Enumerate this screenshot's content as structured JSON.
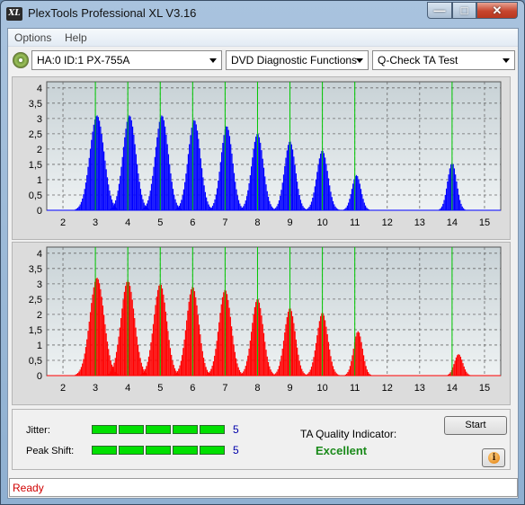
{
  "window": {
    "title": "PlexTools Professional XL V3.16",
    "icon_text": "XL"
  },
  "menu": [
    {
      "label": "Options"
    },
    {
      "label": "Help"
    }
  ],
  "toolbar": {
    "drive": "HA:0 ID:1  PX-755A",
    "function": "DVD Diagnostic Functions",
    "test": "Q-Check TA Test"
  },
  "graphs": {
    "x_ticks": [
      "2",
      "3",
      "4",
      "5",
      "6",
      "7",
      "8",
      "9",
      "10",
      "11",
      "12",
      "13",
      "14",
      "15"
    ],
    "y_ticks": [
      "4",
      "3,5",
      "3",
      "2,5",
      "2",
      "1,5",
      "1",
      "0,5",
      "0"
    ]
  },
  "chart_data": [
    {
      "type": "histogram",
      "series": [
        {
          "color": "#0000ff",
          "peaks": [
            {
              "center": 3.05,
              "height": 3.1,
              "sigma": 0.22
            },
            {
              "center": 4.05,
              "height": 3.1,
              "sigma": 0.2
            },
            {
              "center": 5.05,
              "height": 3.1,
              "sigma": 0.2
            },
            {
              "center": 6.05,
              "height": 2.95,
              "sigma": 0.19
            },
            {
              "center": 7.05,
              "height": 2.75,
              "sigma": 0.18
            },
            {
              "center": 8.0,
              "height": 2.5,
              "sigma": 0.18
            },
            {
              "center": 9.0,
              "height": 2.25,
              "sigma": 0.17
            },
            {
              "center": 10.0,
              "height": 1.95,
              "sigma": 0.17
            },
            {
              "center": 11.05,
              "height": 1.15,
              "sigma": 0.14
            },
            {
              "center": 14.0,
              "height": 1.55,
              "sigma": 0.14
            }
          ]
        }
      ],
      "green_lines": [
        3,
        4,
        5,
        6,
        7,
        8,
        9,
        10,
        11,
        14
      ],
      "xlim": [
        1.5,
        15.5
      ],
      "ylim": [
        0,
        4.2
      ]
    },
    {
      "type": "histogram",
      "series": [
        {
          "color": "#ff0000",
          "peaks": [
            {
              "center": 3.05,
              "height": 3.2,
              "sigma": 0.22
            },
            {
              "center": 4.0,
              "height": 3.1,
              "sigma": 0.21
            },
            {
              "center": 5.0,
              "height": 3.0,
              "sigma": 0.2
            },
            {
              "center": 6.0,
              "height": 2.9,
              "sigma": 0.19
            },
            {
              "center": 7.0,
              "height": 2.8,
              "sigma": 0.19
            },
            {
              "center": 8.0,
              "height": 2.5,
              "sigma": 0.18
            },
            {
              "center": 9.0,
              "height": 2.2,
              "sigma": 0.17
            },
            {
              "center": 10.0,
              "height": 2.05,
              "sigma": 0.17
            },
            {
              "center": 11.1,
              "height": 1.45,
              "sigma": 0.14
            },
            {
              "center": 14.2,
              "height": 0.7,
              "sigma": 0.13
            }
          ]
        }
      ],
      "green_lines": [
        3,
        4,
        5,
        6,
        7,
        8,
        9,
        10,
        11,
        14
      ],
      "xlim": [
        1.5,
        15.5
      ],
      "ylim": [
        0,
        4.2
      ]
    }
  ],
  "jitter": {
    "label": "Jitter:",
    "value": "5",
    "segments": 5
  },
  "peak_shift": {
    "label": "Peak Shift:",
    "value": "5",
    "segments": 5
  },
  "quality": {
    "label": "TA Quality Indicator:",
    "value": "Excellent"
  },
  "start_label": "Start",
  "info_glyph": "i",
  "status": "Ready"
}
